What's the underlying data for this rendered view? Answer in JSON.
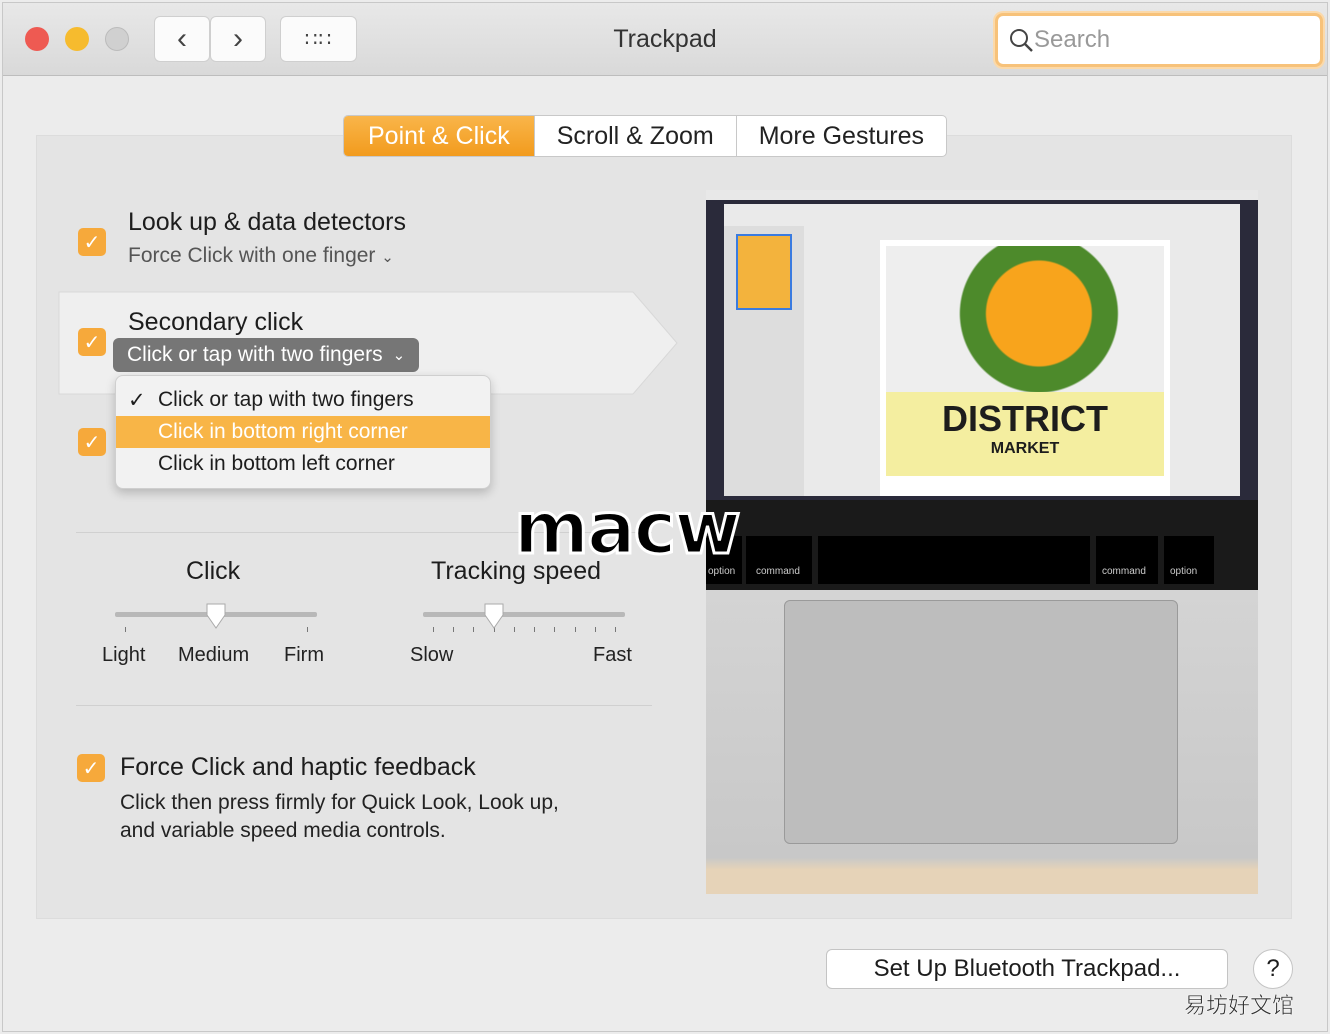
{
  "window": {
    "title": "Trackpad",
    "search_placeholder": "Search",
    "colors": {
      "accent": "#f29b1d",
      "close": "#ee5a52",
      "minimize": "#f6bb2e",
      "zoom": "#cfcfcf"
    }
  },
  "toolbar": {
    "back_icon": "chevron-left-icon",
    "forward_icon": "chevron-right-icon",
    "grid_icon": "grid-icon"
  },
  "tabs": [
    {
      "label": "Point & Click",
      "active": true
    },
    {
      "label": "Scroll & Zoom",
      "active": false
    },
    {
      "label": "More Gestures",
      "active": false
    }
  ],
  "options": {
    "lookup": {
      "label": "Look up & data detectors",
      "value": "Force Click with one finger",
      "checked": true
    },
    "secondary": {
      "label": "Secondary click",
      "value": "Click or tap with two fingers",
      "checked": true,
      "menu": [
        {
          "label": "Click or tap with two fingers",
          "selected": true
        },
        {
          "label": "Click in bottom right corner",
          "highlighted": true
        },
        {
          "label": "Click in bottom left corner"
        }
      ]
    },
    "third_checked": true,
    "force": {
      "label": "Force Click and haptic feedback",
      "description_1": "Click then press firmly for Quick Look, Look up,",
      "description_2": "and variable speed media controls.",
      "checked": true
    }
  },
  "sliders": {
    "click": {
      "title": "Click",
      "labels": [
        "Light",
        "Medium",
        "Firm"
      ],
      "value": 0.5
    },
    "tracking": {
      "title": "Tracking speed",
      "labels": [
        "Slow",
        "Fast"
      ],
      "value": 0.333,
      "ticks": 10
    }
  },
  "preview": {
    "poster_title": "DISTRICT",
    "poster_sub": "MARKET",
    "keys": [
      "option",
      "command",
      "command",
      "option"
    ]
  },
  "buttons": {
    "bluetooth": "Set Up Bluetooth Trackpad...",
    "help": "?"
  },
  "watermarks": {
    "macw": "macw",
    "site": "易坊好文馆"
  }
}
